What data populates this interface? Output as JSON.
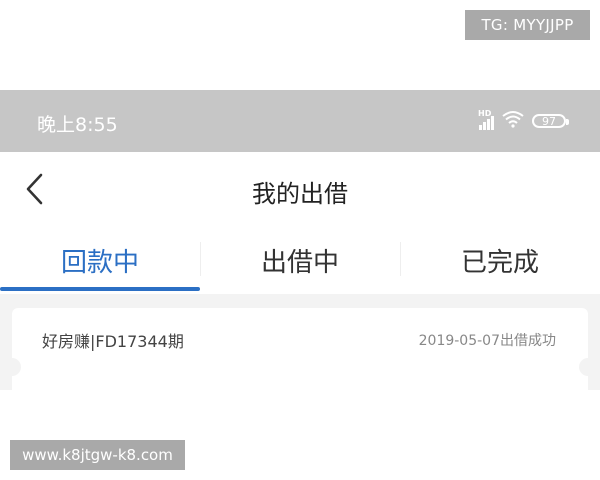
{
  "watermarks": {
    "top": "TG: MYYJJPP",
    "bottom": "www.k8jtgw-k8.com"
  },
  "status_bar": {
    "time": "晚上8:55",
    "signal_label": "HD",
    "battery": "97",
    "icons": [
      "hd-signal-icon",
      "wifi-icon",
      "battery-icon"
    ]
  },
  "header": {
    "back_icon": "chevron-left-icon",
    "title": "我的出借"
  },
  "tabs": [
    {
      "label": "回款中",
      "active": true
    },
    {
      "label": "出借中",
      "active": false
    },
    {
      "label": "已完成",
      "active": false
    }
  ],
  "records": [
    {
      "name": "好房赚|FD17344期",
      "status": "2019-05-07出借成功"
    }
  ],
  "colors": {
    "accent": "#2b6fc4",
    "status_bar": "#c6c6c6",
    "watermark": "#a9a9a9"
  }
}
